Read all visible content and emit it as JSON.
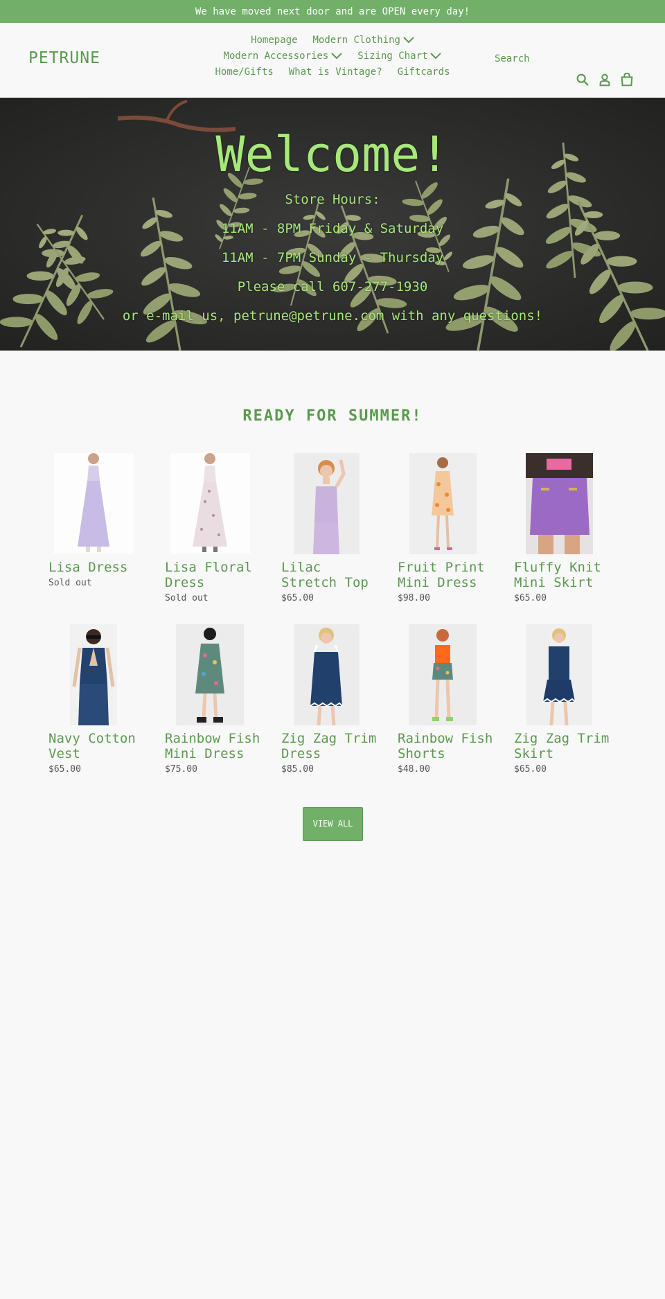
{
  "announcement": "We have moved next door and are OPEN every day!",
  "header": {
    "logo": "PETRUNE",
    "nav": [
      {
        "label": "Homepage"
      },
      {
        "label": "Modern Clothing"
      },
      {
        "label": "Modern Accessories"
      },
      {
        "label": "Sizing Chart"
      },
      {
        "label": "Home/Gifts"
      },
      {
        "label": "What is Vintage?"
      },
      {
        "label": "Giftcards"
      }
    ],
    "search_label": "Search"
  },
  "hero": {
    "title": "Welcome!",
    "lines": [
      "Store Hours:",
      "11AM - 8PM Friday & Saturday",
      "11AM - 7PM Sunday - Thursday",
      "Please call 607-277-1930",
      "or e-mail us, petrune@petrune.com with any questions!"
    ]
  },
  "collection": {
    "title": "READY FOR SUMMER!",
    "products": [
      {
        "name": "Lisa Dress",
        "price": "Sold out"
      },
      {
        "name": "Lisa Floral Dress",
        "price": "Sold out"
      },
      {
        "name": "Lilac Stretch Top",
        "price": "$65.00"
      },
      {
        "name": "Fruit Print Mini Dress",
        "price": "$98.00"
      },
      {
        "name": "Fluffy Knit Mini Skirt",
        "price": "$65.00"
      },
      {
        "name": "Navy Cotton Vest",
        "price": "$65.00"
      },
      {
        "name": "Rainbow Fish Mini Dress",
        "price": "$75.00"
      },
      {
        "name": "Zig Zag Trim Dress",
        "price": "$85.00"
      },
      {
        "name": "Rainbow Fish Shorts",
        "price": "$48.00"
      },
      {
        "name": "Zig Zag Trim Skirt",
        "price": "$65.00"
      }
    ],
    "view_all": "VIEW ALL"
  },
  "colors": {
    "brand_green": "#72b06a",
    "link_green": "#5a9a4e",
    "hero_text": "#a6e87a"
  },
  "icons": [
    "search-icon",
    "account-icon",
    "cart-icon",
    "chevron-down-icon"
  ]
}
